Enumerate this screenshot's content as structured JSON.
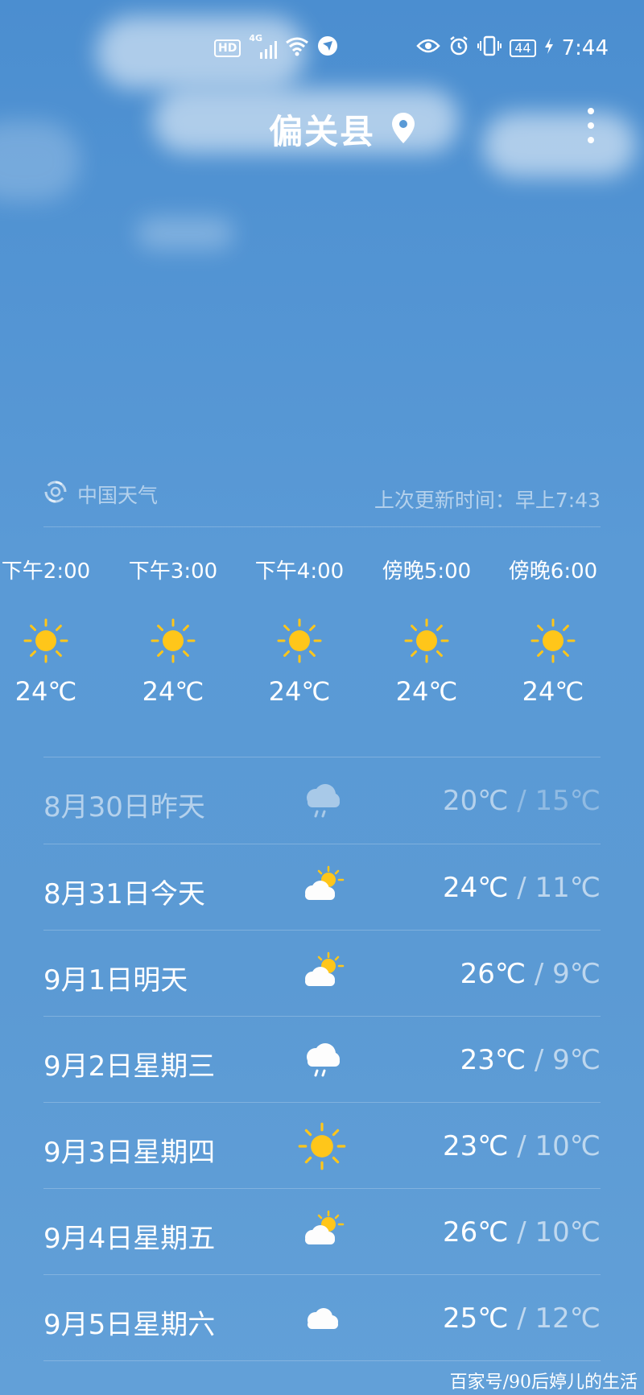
{
  "status_bar": {
    "hd": "HD",
    "network": "4G",
    "battery": "44",
    "time": "7:44"
  },
  "header": {
    "city": "偏关县"
  },
  "source": {
    "name": "中国天气",
    "updated": "上次更新时间：早上7:43"
  },
  "hourly": [
    {
      "time": "下午2:00",
      "icon": "sun-icon",
      "temp": "24℃"
    },
    {
      "time": "下午3:00",
      "icon": "sun-icon",
      "temp": "24℃"
    },
    {
      "time": "下午4:00",
      "icon": "sun-icon",
      "temp": "24℃"
    },
    {
      "time": "傍晚5:00",
      "icon": "sun-icon",
      "temp": "24℃"
    },
    {
      "time": "傍晚6:00",
      "icon": "sun-icon",
      "temp": "24℃"
    }
  ],
  "daily": [
    {
      "label": "8月30日昨天",
      "icon": "rain-cloud-icon",
      "high": "20℃",
      "low": "15℃"
    },
    {
      "label": "8月31日今天",
      "icon": "partly-cloudy-icon",
      "high": "24℃",
      "low": "11℃"
    },
    {
      "label": "9月1日明天",
      "icon": "partly-cloudy-icon",
      "high": "26℃",
      "low": "9℃"
    },
    {
      "label": "9月2日星期三",
      "icon": "rain-cloud-icon",
      "high": "23℃",
      "low": "9℃"
    },
    {
      "label": "9月3日星期四",
      "icon": "sun-icon",
      "high": "23℃",
      "low": "10℃"
    },
    {
      "label": "9月4日星期五",
      "icon": "partly-cloudy-icon",
      "high": "26℃",
      "low": "10℃"
    },
    {
      "label": "9月5日星期六",
      "icon": "cloud-icon",
      "high": "25℃",
      "low": "12℃"
    }
  ],
  "temp_separator": " / ",
  "watermark": "百家号/90后婷儿的生活",
  "colors": {
    "sky_top": "#4b8ed0",
    "sky_bottom": "#62a0d8",
    "sun": "#ffc61a"
  }
}
